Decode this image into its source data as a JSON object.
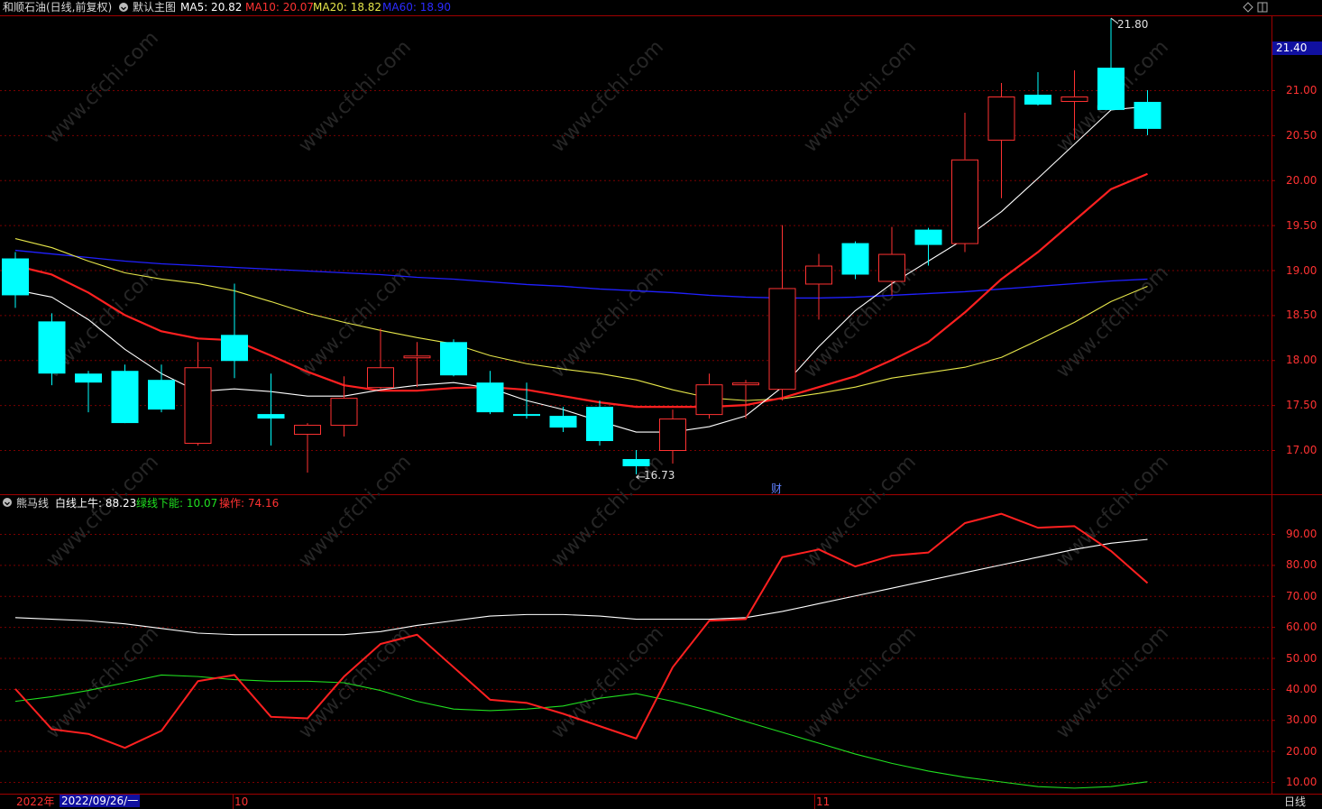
{
  "header": {
    "stock_title": "和顺石油(日线,前复权)",
    "main_chart_name": "默认主图",
    "ma5": "MA5: 20.82",
    "ma10": "MA10: 20.07",
    "ma20": "MA20: 18.82",
    "ma60": "MA60: 18.90"
  },
  "indicator_header": {
    "name": "熊马线",
    "white": "白线上牛: 88.23",
    "green": "绿线下能: 10.07",
    "red": "操作: 74.16"
  },
  "price_axis_labels": [
    "21.00",
    "20.50",
    "20.00",
    "19.50",
    "19.00",
    "18.50",
    "18.00",
    "17.50",
    "17.00"
  ],
  "current_price": "21.40",
  "high_marker": "21.80",
  "low_marker": "16.73",
  "fin_marker": "财",
  "indicator_axis_labels": [
    "90.00",
    "80.00",
    "70.00",
    "60.00",
    "50.00",
    "40.00",
    "30.00",
    "20.00",
    "10.00"
  ],
  "footer": {
    "year": "2022年",
    "date": "2022/09/26/一",
    "month_oct": "10",
    "month_nov": "11",
    "period": "日线"
  },
  "watermark": "www.cfchi.com",
  "colors": {
    "up": "#ff3232",
    "down": "#00ffff",
    "ma5": "#ffffff",
    "ma10": "#ff2020",
    "ma20": "#e6e64a",
    "ma60": "#2020ff",
    "grid": "#7a0000"
  },
  "chart_data": [
    {
      "type": "candlestick",
      "title": "",
      "ylim": [
        16.6,
        22.0
      ],
      "candles": [
        {
          "o": 19.13,
          "h": 19.2,
          "l": 18.58,
          "c": 18.72
        },
        {
          "o": 18.43,
          "h": 18.52,
          "l": 17.72,
          "c": 17.85
        },
        {
          "o": 17.85,
          "h": 17.88,
          "l": 17.42,
          "c": 17.75
        },
        {
          "o": 17.88,
          "h": 17.95,
          "l": 17.3,
          "c": 17.3
        },
        {
          "o": 17.78,
          "h": 17.95,
          "l": 17.42,
          "c": 17.45
        },
        {
          "o": 17.08,
          "h": 18.2,
          "l": 17.05,
          "c": 17.92
        },
        {
          "o": 18.28,
          "h": 18.85,
          "l": 17.8,
          "c": 17.99
        },
        {
          "o": 17.4,
          "h": 17.85,
          "l": 17.05,
          "c": 17.35
        },
        {
          "o": 17.18,
          "h": 17.3,
          "l": 16.75,
          "c": 17.28
        },
        {
          "o": 17.28,
          "h": 17.82,
          "l": 17.15,
          "c": 17.58
        },
        {
          "o": 17.7,
          "h": 18.35,
          "l": 17.68,
          "c": 17.92
        },
        {
          "o": 18.03,
          "h": 18.2,
          "l": 17.7,
          "c": 18.05
        },
        {
          "o": 18.2,
          "h": 18.23,
          "l": 17.82,
          "c": 17.83
        },
        {
          "o": 17.75,
          "h": 17.88,
          "l": 17.4,
          "c": 17.42
        },
        {
          "o": 17.4,
          "h": 17.75,
          "l": 17.35,
          "c": 17.38
        },
        {
          "o": 17.38,
          "h": 17.48,
          "l": 17.2,
          "c": 17.25
        },
        {
          "o": 17.48,
          "h": 17.55,
          "l": 17.05,
          "c": 17.1
        },
        {
          "o": 16.9,
          "h": 17.0,
          "l": 16.73,
          "c": 16.82
        },
        {
          "o": 17.0,
          "h": 17.45,
          "l": 16.85,
          "c": 17.35
        },
        {
          "o": 17.4,
          "h": 17.85,
          "l": 17.35,
          "c": 17.73
        },
        {
          "o": 17.73,
          "h": 17.78,
          "l": 17.35,
          "c": 17.75
        },
        {
          "o": 17.68,
          "h": 19.5,
          "l": 17.55,
          "c": 18.8
        },
        {
          "o": 18.85,
          "h": 19.18,
          "l": 18.45,
          "c": 19.05
        },
        {
          "o": 19.3,
          "h": 19.32,
          "l": 18.9,
          "c": 18.95
        },
        {
          "o": 18.88,
          "h": 19.48,
          "l": 18.72,
          "c": 19.18
        },
        {
          "o": 19.45,
          "h": 19.47,
          "l": 19.05,
          "c": 19.28
        },
        {
          "o": 19.3,
          "h": 20.75,
          "l": 19.2,
          "c": 20.23
        },
        {
          "o": 20.45,
          "h": 21.08,
          "l": 19.8,
          "c": 20.93
        },
        {
          "o": 20.95,
          "h": 21.2,
          "l": 20.83,
          "c": 20.84
        },
        {
          "o": 20.88,
          "h": 21.22,
          "l": 20.45,
          "c": 20.93
        },
        {
          "o": 21.25,
          "h": 21.8,
          "l": 20.78,
          "c": 20.78
        },
        {
          "o": 20.87,
          "h": 21.0,
          "l": 20.5,
          "c": 20.57
        }
      ],
      "ma5": [
        18.78,
        18.7,
        18.45,
        18.12,
        17.85,
        17.65,
        17.68,
        17.65,
        17.6,
        17.6,
        17.67,
        17.72,
        17.75,
        17.69,
        17.55,
        17.45,
        17.32,
        17.2,
        17.2,
        17.26,
        17.38,
        17.7,
        18.15,
        18.55,
        18.85,
        19.1,
        19.35,
        19.65,
        20.02,
        20.4,
        20.78,
        20.82
      ],
      "ma10": [
        19.05,
        18.95,
        18.75,
        18.5,
        18.32,
        18.24,
        18.22,
        18.05,
        17.87,
        17.72,
        17.66,
        17.66,
        17.69,
        17.7,
        17.67,
        17.6,
        17.53,
        17.48,
        17.48,
        17.48,
        17.5,
        17.58,
        17.7,
        17.82,
        18.0,
        18.2,
        18.53,
        18.9,
        19.2,
        19.55,
        19.9,
        20.07
      ],
      "ma20": [
        19.35,
        19.25,
        19.1,
        18.97,
        18.9,
        18.85,
        18.77,
        18.65,
        18.52,
        18.42,
        18.33,
        18.25,
        18.18,
        18.05,
        17.96,
        17.9,
        17.85,
        17.78,
        17.67,
        17.58,
        17.55,
        17.57,
        17.63,
        17.7,
        17.8,
        17.86,
        17.92,
        18.03,
        18.22,
        18.42,
        18.65,
        18.82
      ],
      "ma60": [
        19.22,
        19.18,
        19.14,
        19.1,
        19.07,
        19.05,
        19.03,
        19.01,
        18.99,
        18.97,
        18.95,
        18.92,
        18.9,
        18.87,
        18.84,
        18.82,
        18.79,
        18.77,
        18.75,
        18.72,
        18.7,
        18.69,
        18.69,
        18.7,
        18.72,
        18.74,
        18.76,
        18.79,
        18.82,
        18.85,
        18.88,
        18.9
      ]
    },
    {
      "type": "line",
      "title": "",
      "ylim": [
        5,
        100
      ],
      "series": [
        {
          "name": "白线上牛",
          "color": "#ffffff",
          "values": [
            63,
            62.5,
            62,
            61,
            59.5,
            58,
            57.5,
            57.5,
            57.5,
            57.5,
            58.5,
            60.5,
            62,
            63.5,
            64,
            64,
            63.5,
            62.5,
            62.5,
            62.5,
            63,
            65,
            67.5,
            70,
            72.5,
            75,
            77.5,
            80,
            82.5,
            85,
            87,
            88.23
          ]
        },
        {
          "name": "绿线下能",
          "color": "#20e020",
          "values": [
            36,
            37.5,
            39.5,
            42,
            44.5,
            44,
            43,
            42.5,
            42.5,
            42,
            39.5,
            36,
            33.5,
            33,
            33.5,
            34.5,
            37,
            38.5,
            36,
            33,
            29.5,
            26,
            22.5,
            19,
            16,
            13.5,
            11.5,
            10,
            8.5,
            8,
            8.5,
            10.07
          ]
        },
        {
          "name": "操作",
          "color": "#ff2020",
          "values": [
            40,
            27,
            25.5,
            21,
            26.5,
            42.5,
            44.5,
            31,
            30.5,
            44,
            54.5,
            57.5,
            47,
            36.5,
            35.5,
            32,
            28,
            24,
            47,
            62,
            62.5,
            82.5,
            85,
            79.5,
            83,
            84,
            93.5,
            96.5,
            92,
            92.5,
            84.5,
            74.16
          ]
        }
      ]
    }
  ]
}
